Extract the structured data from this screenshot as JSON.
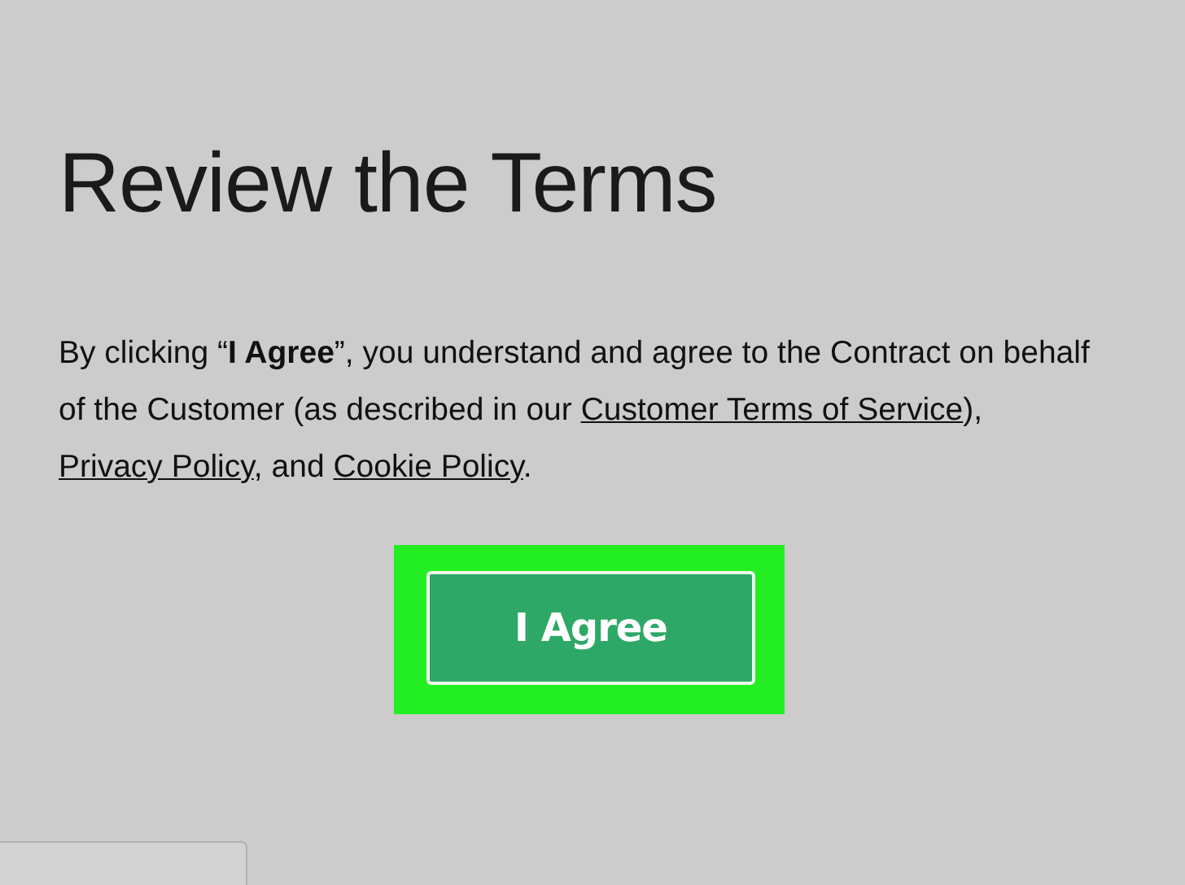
{
  "title": "Review the Terms",
  "paragraph": [
    {
      "kind": "text",
      "text": "By clicking “**I Agree**”, you understand and agree to the Contract on behalf of the Customer (as described in our "
    },
    {
      "kind": "link",
      "text": "Customer Terms of Service"
    },
    {
      "kind": "text",
      "text": "), "
    },
    {
      "kind": "link",
      "text": "Privacy Policy"
    },
    {
      "kind": "text",
      "text": ", and "
    },
    {
      "kind": "link",
      "text": "Cookie Policy"
    },
    {
      "kind": "text",
      "text": "."
    }
  ],
  "button": {
    "label": "I Agree"
  }
}
